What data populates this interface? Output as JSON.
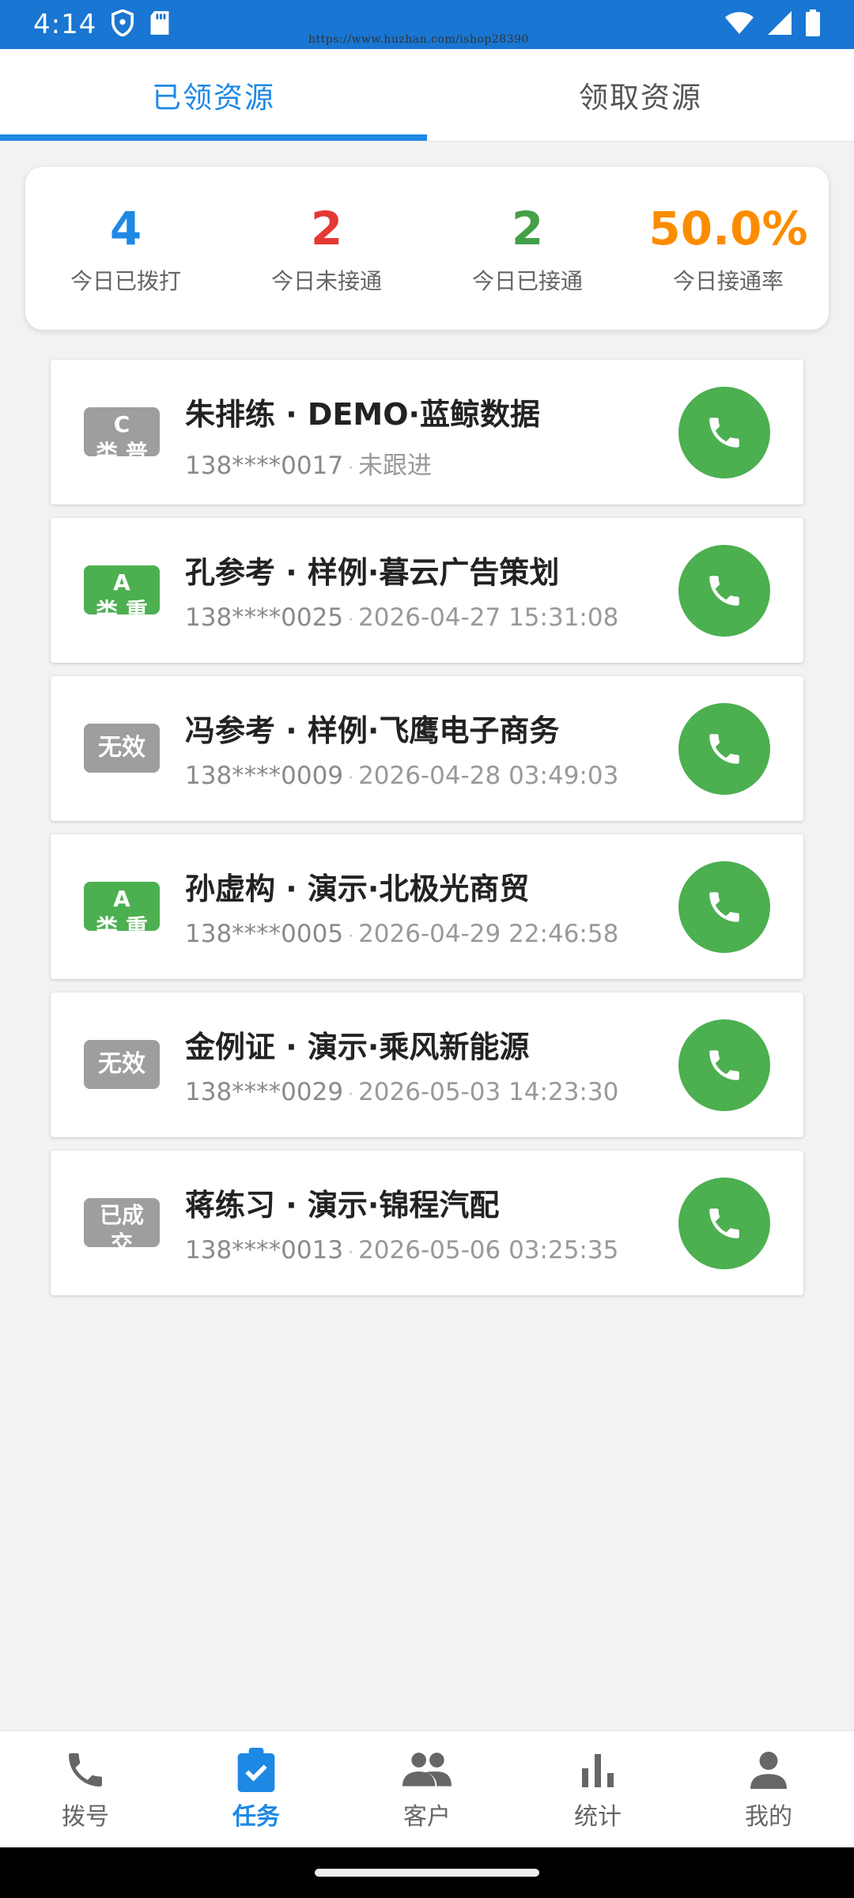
{
  "status_bar": {
    "time": "4:14",
    "watermark": "https://www.huzhan.com/ishop28390"
  },
  "tabs": [
    {
      "label": "已领资源",
      "active": true
    },
    {
      "label": "领取资源",
      "active": false
    }
  ],
  "stats": [
    {
      "value": "4",
      "label": "今日已拨打",
      "color": "#1e88e5"
    },
    {
      "value": "2",
      "label": "今日未接通",
      "color": "#e53935"
    },
    {
      "value": "2",
      "label": "今日已接通",
      "color": "#43a047"
    },
    {
      "value": "50.0%",
      "label": "今日接通率",
      "color": "#fb8c00"
    }
  ],
  "list": [
    {
      "badge": "C\n类 普",
      "badge_color": "#9e9e9e",
      "name": "朱排练 · DEMO·蓝鲸数据",
      "phone": "138****0017",
      "meta": "未跟进"
    },
    {
      "badge": "A\n类 重",
      "badge_color": "#4caf50",
      "name": "孔参考 · 样例·暮云广告策划",
      "phone": "138****0025",
      "meta": "2026-04-27 15:31:08"
    },
    {
      "badge": "无效",
      "badge_color": "#9e9e9e",
      "name": "冯参考 · 样例·飞鹰电子商务",
      "phone": "138****0009",
      "meta": "2026-04-28 03:49:03"
    },
    {
      "badge": "A\n类 重",
      "badge_color": "#4caf50",
      "name": "孙虚构 · 演示·北极光商贸",
      "phone": "138****0005",
      "meta": "2026-04-29 22:46:58"
    },
    {
      "badge": "无效",
      "badge_color": "#9e9e9e",
      "name": "金例证 · 演示·乘风新能源",
      "phone": "138****0029",
      "meta": "2026-05-03 14:23:30"
    },
    {
      "badge": "已成\n交",
      "badge_color": "#9e9e9e",
      "name": "蒋练习 · 演示·锦程汽配",
      "phone": "138****0013",
      "meta": "2026-05-06 03:25:35"
    }
  ],
  "bottom_nav": [
    {
      "label": "拨号",
      "icon": "phone-icon",
      "active": false
    },
    {
      "label": "任务",
      "icon": "clipboard-check-icon",
      "active": true
    },
    {
      "label": "客户",
      "icon": "people-icon",
      "active": false
    },
    {
      "label": "统计",
      "icon": "bar-chart-icon",
      "active": false
    },
    {
      "label": "我的",
      "icon": "person-icon",
      "active": false
    }
  ],
  "colors": {
    "primary": "#1e88e5",
    "call_green": "#4caf50"
  }
}
